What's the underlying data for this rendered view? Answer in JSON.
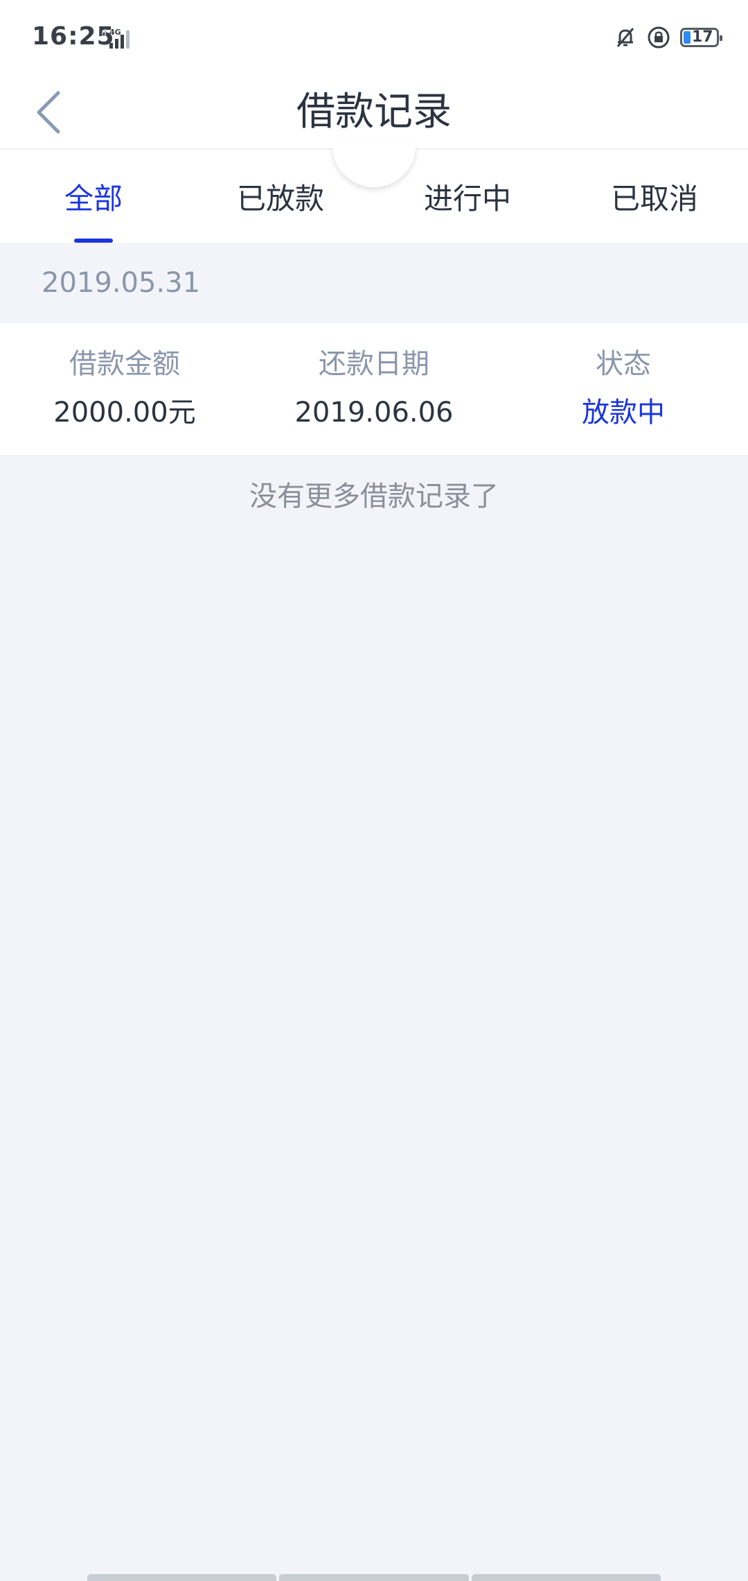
{
  "status_bar": {
    "time": "16:25",
    "network": "4G",
    "battery_level": "17",
    "icons": [
      "bell-off-icon",
      "rotation-lock-icon",
      "battery-icon"
    ]
  },
  "nav": {
    "title": "借款记录",
    "back_icon": "chevron-left-icon"
  },
  "tabs": [
    {
      "label": "全部",
      "active": true
    },
    {
      "label": "已放款",
      "active": false
    },
    {
      "label": "进行中",
      "active": false
    },
    {
      "label": "已取消",
      "active": false
    }
  ],
  "records": [
    {
      "date": "2019.05.31",
      "amount_label": "借款金额",
      "amount": "2000.00元",
      "repay_label": "还款日期",
      "repay_date": "2019.06.06",
      "status_label": "状态",
      "status": "放款中"
    }
  ],
  "footer_text": "没有更多借款记录了",
  "colors": {
    "accent": "#1a35e0",
    "text_primary": "#2c3340",
    "text_secondary": "#8a96ab",
    "background": "#f2f4f9"
  }
}
